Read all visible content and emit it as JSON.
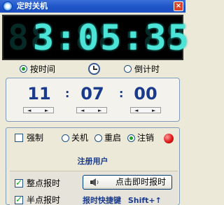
{
  "window": {
    "title": "定时关机",
    "close_label": "×"
  },
  "clock": {
    "display": "3:05:35",
    "ghost": "88:88:88"
  },
  "mode": {
    "by_time_label": "按时间",
    "countdown_label": "倒计时",
    "selected": "by_time"
  },
  "time": {
    "hour": "11",
    "minute": "07",
    "second": "00",
    "separator": ":",
    "spin_left": "◄",
    "spin_right": "►"
  },
  "actions": {
    "force_label": "强制",
    "shutdown_label": "关机",
    "restart_label": "重启",
    "logoff_label": "注销",
    "selected": "logoff"
  },
  "status": {
    "text": "注册用户"
  },
  "chime": {
    "hourly_label": "整点报时",
    "half_label": "半点报时",
    "now_button": "点击即时报时",
    "hotkey_label": "报时快捷键",
    "hotkey_value": "Shift+↑"
  },
  "colors": {
    "accent": "#4de4d8",
    "title_bar": "#1f56c9",
    "number": "#1a3a8c"
  }
}
